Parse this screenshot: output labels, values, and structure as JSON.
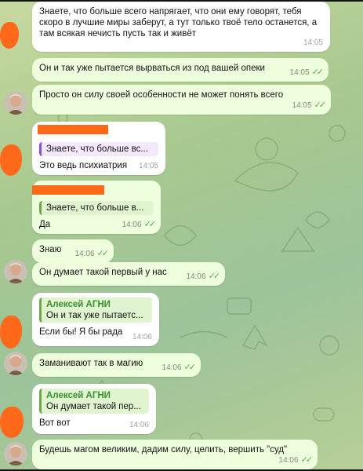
{
  "messages": [
    {
      "id": "m1",
      "direction": "out",
      "text": "Знаете, что больше всего напрягает, что они ему говорят, тебя скоро в лучшие миры заберут, а тут только твоё тело останется, а там всякая нечисть пусть так и живёт",
      "time": "14:05"
    },
    {
      "id": "m2",
      "direction": "in",
      "text": "Он и так уже пытается вырваться из под вашей опеки",
      "time": "14:05",
      "read": true
    },
    {
      "id": "m3",
      "direction": "in",
      "text": "Просто он силу своей особенности не может понять всего",
      "time": "14:05",
      "read": true
    },
    {
      "id": "m4",
      "direction": "out",
      "quote": "Знаете, что больше вс...",
      "text": "Это ведь психиатрия",
      "time": "14:05"
    },
    {
      "id": "m5",
      "direction": "in",
      "quote": "Знаете, что больше в...",
      "text": "Да",
      "time": "14:06",
      "read": true
    },
    {
      "id": "m6",
      "direction": "in",
      "text": "Знаю",
      "time": "14:06",
      "read": true
    },
    {
      "id": "m7",
      "direction": "in",
      "text": "Он думает такой первый у нас",
      "time": "14:06",
      "read": true
    },
    {
      "id": "m8",
      "direction": "out",
      "quote_author": "Алексей АГНИ",
      "quote": "Он и так уже пытаетс...",
      "text": "Если бы! Я бы рада",
      "time": "14:06"
    },
    {
      "id": "m9",
      "direction": "in",
      "text": "Заманивают так в магию",
      "time": "14:06",
      "read": true
    },
    {
      "id": "m10",
      "direction": "out",
      "quote_author": "Алексей АГНИ",
      "quote": "Он думает такой пер...",
      "text": "Вот вот",
      "time": "14:06"
    },
    {
      "id": "m11",
      "direction": "in",
      "text": "Будешь магом великим, дадим силу, целить, вершить \"суд\"",
      "time": "14:06",
      "read": true
    }
  ],
  "colors": {
    "redaction": "#ff6a1a",
    "outgoing_bubble": "#ffffff",
    "incoming_bubble": "#eeffde",
    "check": "#5ea84f",
    "quote_author": "#3a8f2f"
  },
  "icons": {
    "read_receipt": "double-check-icon",
    "avatar": "user-avatar"
  }
}
